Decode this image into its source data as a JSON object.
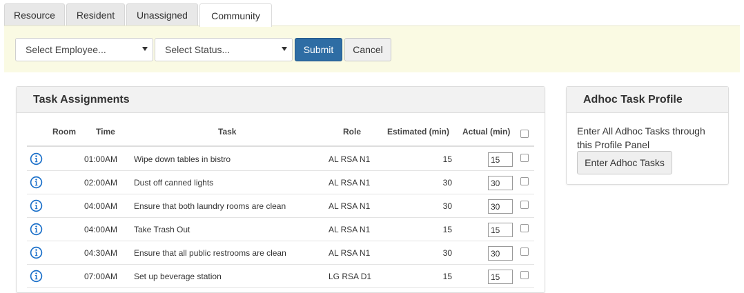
{
  "tabs": [
    {
      "label": "Resource",
      "active": false
    },
    {
      "label": "Resident",
      "active": false
    },
    {
      "label": "Unassigned",
      "active": false
    },
    {
      "label": "Community",
      "active": true
    }
  ],
  "filters": {
    "employee_select": "Select Employee...",
    "status_select": "Select Status...",
    "submit_label": "Submit",
    "cancel_label": "Cancel"
  },
  "task_panel": {
    "title": "Task Assignments",
    "columns": [
      "Room",
      "Time",
      "Task",
      "Role",
      "Estimated (min)",
      "Actual (min)"
    ],
    "rows": [
      {
        "room": "",
        "time": "01:00AM",
        "task": "Wipe down tables in bistro",
        "role": "AL RSA N1",
        "estimated": "15",
        "actual": "15"
      },
      {
        "room": "",
        "time": "02:00AM",
        "task": "Dust off canned lights",
        "role": "AL RSA N1",
        "estimated": "30",
        "actual": "30"
      },
      {
        "room": "",
        "time": "04:00AM",
        "task": "Ensure that both laundry rooms are clean",
        "role": "AL RSA N1",
        "estimated": "30",
        "actual": "30"
      },
      {
        "room": "",
        "time": "04:00AM",
        "task": "Take Trash Out",
        "role": "AL RSA N1",
        "estimated": "15",
        "actual": "15"
      },
      {
        "room": "",
        "time": "04:30AM",
        "task": "Ensure that all public restrooms are clean",
        "role": "AL RSA N1",
        "estimated": "30",
        "actual": "30"
      },
      {
        "room": "",
        "time": "07:00AM",
        "task": "Set up beverage station",
        "role": "LG RSA D1",
        "estimated": "15",
        "actual": "15"
      }
    ]
  },
  "adhoc_panel": {
    "title": "Adhoc Task Profile",
    "description": "Enter All Adhoc Tasks through this Profile Panel",
    "button_label": "Enter Adhoc Tasks"
  },
  "colors": {
    "primary_button": "#2e6da4",
    "filter_bar_bg": "#fafae3",
    "info_icon": "#1a6fc9"
  },
  "icons": {
    "row_info": "info-circle-icon",
    "select_caret": "caret-down-icon"
  }
}
